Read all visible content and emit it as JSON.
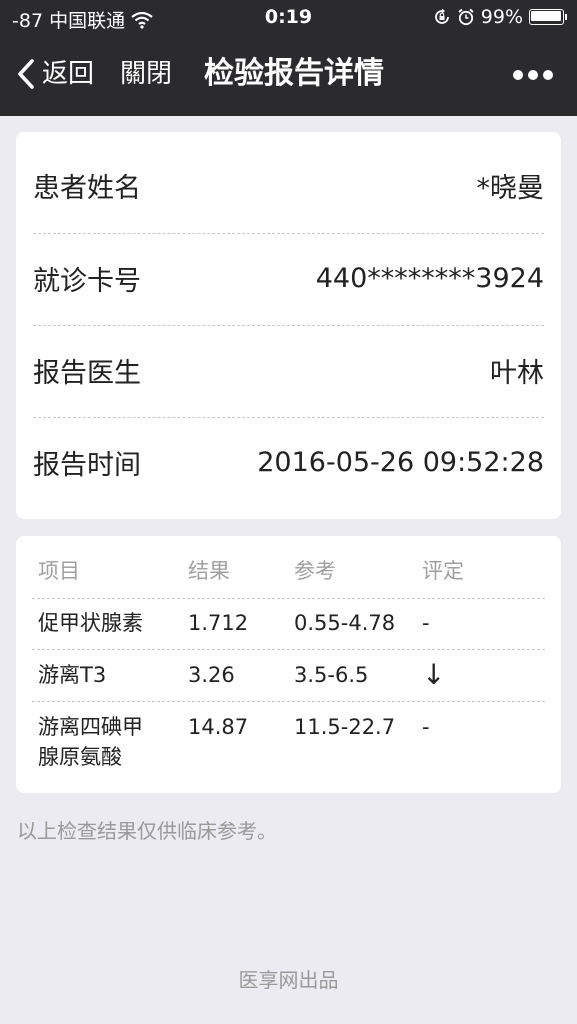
{
  "status_bar": {
    "carrier": "-87 中国联通",
    "time": "0:19",
    "battery": "99%",
    "battery_level": 0.99,
    "icons": [
      "wifi-icon",
      "rotation-lock-icon",
      "alarm-icon",
      "battery-icon"
    ]
  },
  "nav": {
    "back_label": "返回",
    "close_label": "關閉",
    "title": "检验报告详情",
    "icons": [
      "chevron-left-icon",
      "more-icon"
    ]
  },
  "patient_info": [
    {
      "label": "患者姓名",
      "value": "*晓曼"
    },
    {
      "label": "就诊卡号",
      "value": "440********3924"
    },
    {
      "label": "报告医生",
      "value": "叶林"
    },
    {
      "label": "报告时间",
      "value": "2016-05-26 09:52:28"
    }
  ],
  "results": {
    "headers": [
      "项目",
      "结果",
      "参考",
      "评定"
    ],
    "rows": [
      {
        "item": "促甲状腺素",
        "result": "1.712",
        "reference": "0.55-4.78",
        "rating": "-"
      },
      {
        "item": "游离T3",
        "result": "3.26",
        "reference": "3.5-6.5",
        "rating": "↓"
      },
      {
        "item_line1": "游离四碘甲",
        "item_line2": "腺原氨酸",
        "result": "14.87",
        "reference": "11.5-22.7",
        "rating": "-"
      }
    ]
  },
  "footnote": "以上检查结果仅供临床参考。",
  "credit": "医享网出品",
  "colors": {
    "topbar": "#2b2b2d",
    "background": "#ebebf1",
    "card": "#ffffff",
    "muted_text": "#9a9a9a"
  }
}
